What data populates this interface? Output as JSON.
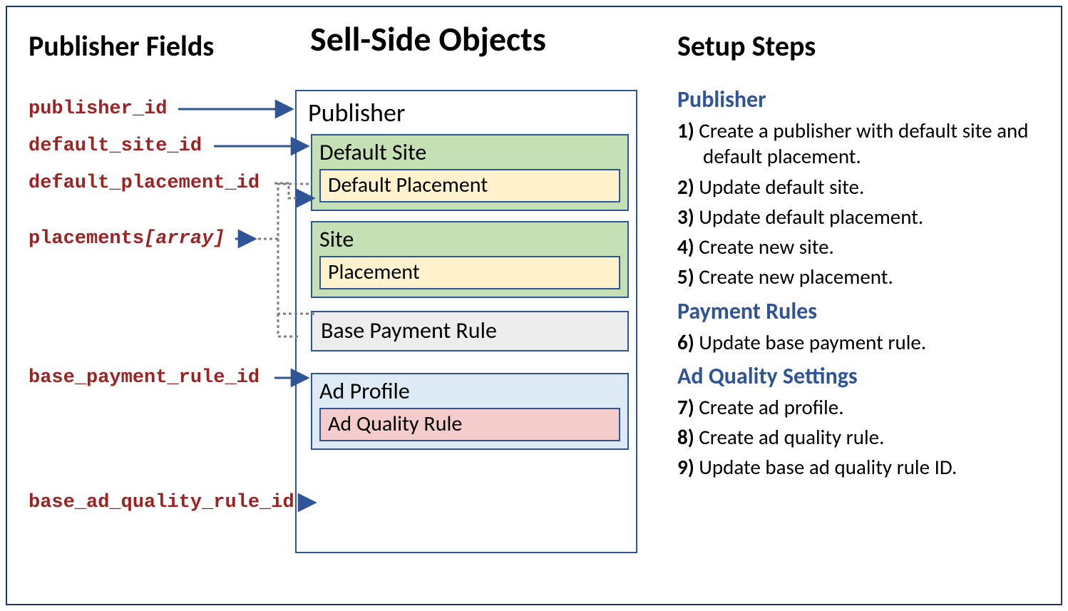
{
  "titles": {
    "left": "Publisher Fields",
    "center": "Sell-Side Objects",
    "right": "Setup Steps"
  },
  "fields": {
    "publisher_id": "publisher_id",
    "default_site_id": "default_site_id",
    "default_placement_id": "default_placement_id",
    "placements_array_pre": "placements",
    "placements_array_suf": "[array]",
    "base_payment_rule_id": "base_payment_rule_id",
    "base_ad_quality_rule_id": "base_ad_quality_rule_id"
  },
  "objects": {
    "publisher": "Publisher",
    "default_site": "Default Site",
    "default_placement": "Default Placement",
    "site": "Site",
    "placement": "Placement",
    "base_payment_rule": "Base Payment Rule",
    "ad_profile": "Ad Profile",
    "ad_quality_rule": "Ad Quality Rule"
  },
  "sections": {
    "publisher": "Publisher",
    "payment_rules": "Payment Rules",
    "ad_quality": "Ad Quality Settings"
  },
  "steps": {
    "s1n": "1)",
    "s1t": " Create a publisher with default site and default placement.",
    "s2n": "2)",
    "s2t": " Update default site.",
    "s3n": "3)",
    "s3t": " Update default placement.",
    "s4n": "4)",
    "s4t": " Create new site.",
    "s5n": "5)",
    "s5t": " Create new placement.",
    "s6n": "6)",
    "s6t": " Update base payment rule.",
    "s7n": "7)",
    "s7t": " Create ad profile.",
    "s8n": "8)",
    "s8t": " Create ad quality rule.",
    "s9n": "9)",
    "s9t": " Update base ad quality rule ID."
  }
}
